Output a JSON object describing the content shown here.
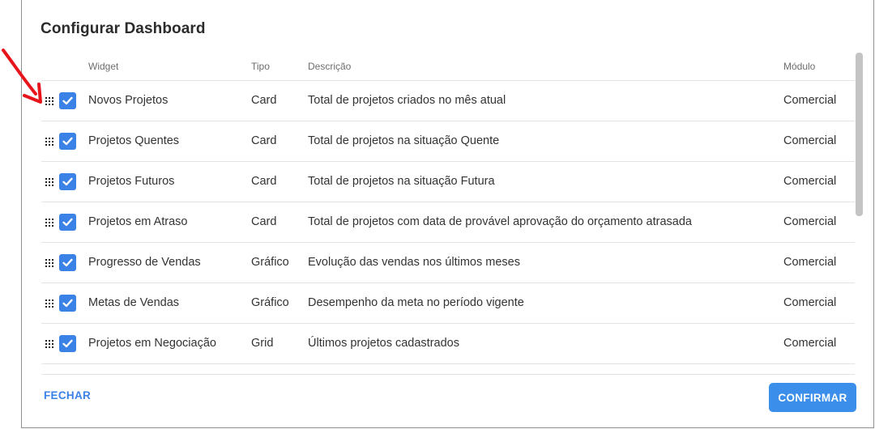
{
  "dialog": {
    "title": "Configurar Dashboard"
  },
  "table": {
    "headers": {
      "widget": "Widget",
      "tipo": "Tipo",
      "descricao": "Descrição",
      "modulo": "Módulo"
    },
    "rows": [
      {
        "widget": "Novos Projetos",
        "tipo": "Card",
        "descricao": "Total de projetos criados no mês atual",
        "modulo": "Comercial",
        "checked": true
      },
      {
        "widget": "Projetos Quentes",
        "tipo": "Card",
        "descricao": "Total de projetos na situação Quente",
        "modulo": "Comercial",
        "checked": true
      },
      {
        "widget": "Projetos Futuros",
        "tipo": "Card",
        "descricao": "Total de projetos na situação Futura",
        "modulo": "Comercial",
        "checked": true
      },
      {
        "widget": "Projetos em Atraso",
        "tipo": "Card",
        "descricao": "Total de projetos com data de provável aprovação do orçamento atrasada",
        "modulo": "Comercial",
        "checked": true
      },
      {
        "widget": "Progresso de Vendas",
        "tipo": "Gráfico",
        "descricao": "Evolução das vendas nos últimos meses",
        "modulo": "Comercial",
        "checked": true
      },
      {
        "widget": "Metas de Vendas",
        "tipo": "Gráfico",
        "descricao": "Desempenho da meta no período vigente",
        "modulo": "Comercial",
        "checked": true
      },
      {
        "widget": "Projetos em Negociação",
        "tipo": "Grid",
        "descricao": "Últimos projetos cadastrados",
        "modulo": "Comercial",
        "checked": true
      }
    ]
  },
  "footer": {
    "close_label": "FECHAR",
    "confirm_label": "CONFIRMAR"
  },
  "icons": {
    "drag": "drag-handle-icon",
    "check": "checkbox-checked-icon",
    "annotation": "red-arrow-icon"
  },
  "colors": {
    "accent": "#3b82e6",
    "annotation": "#e8141b"
  }
}
